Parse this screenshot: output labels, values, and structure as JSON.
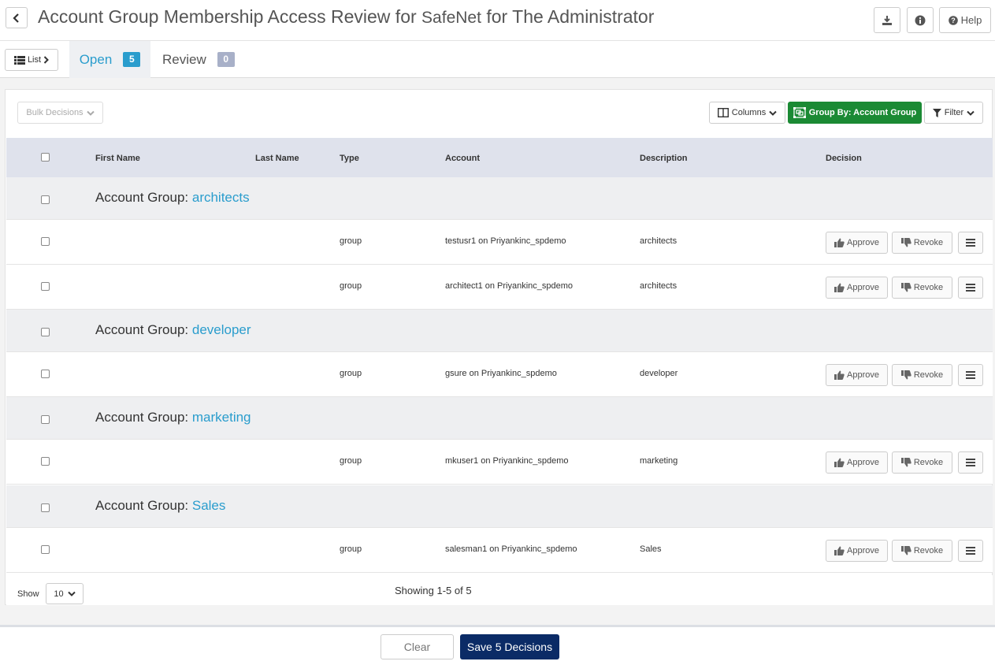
{
  "header": {
    "title_prefix": "Account Group Membership Access Review for",
    "app_name": "SafeNet",
    "title_suffix": "for The Administrator",
    "help_label": "Help"
  },
  "tabs": {
    "list_label": "List",
    "open_label": "Open",
    "open_count": "5",
    "review_label": "Review",
    "review_count": "0"
  },
  "toolbar": {
    "bulk_label": "Bulk Decisions",
    "columns_label": "Columns",
    "groupby_label": "Group By: Account Group",
    "filter_label": "Filter"
  },
  "table": {
    "headers": {
      "first_name": "First Name",
      "last_name": "Last Name",
      "type": "Type",
      "account": "Account",
      "description": "Description",
      "decision": "Decision"
    },
    "group_prefix": "Account Group:",
    "approve_label": "Approve",
    "revoke_label": "Revoke",
    "groups": [
      {
        "name": "architects",
        "items": [
          {
            "type": "group",
            "account": "testusr1 on Priyankinc_spdemo",
            "description": "architects"
          },
          {
            "type": "group",
            "account": "architect1 on Priyankinc_spdemo",
            "description": "architects"
          }
        ]
      },
      {
        "name": "developer",
        "items": [
          {
            "type": "group",
            "account": "gsure on Priyankinc_spdemo",
            "description": "developer"
          }
        ]
      },
      {
        "name": "marketing",
        "items": [
          {
            "type": "group",
            "account": "mkuser1 on Priyankinc_spdemo",
            "description": "marketing"
          }
        ]
      },
      {
        "name": "Sales",
        "items": [
          {
            "type": "group",
            "account": "salesman1 on Priyankinc_spdemo",
            "description": "Sales"
          }
        ]
      }
    ]
  },
  "pagination": {
    "show_label": "Show",
    "page_size": "10",
    "showing_text": "Showing 1-5 of 5"
  },
  "footer": {
    "clear_label": "Clear",
    "save_label": "Save 5 Decisions"
  },
  "colors": {
    "accent": "#2a9dcd",
    "group_by_green": "#1b8a34",
    "save_navy": "#0b2b66"
  }
}
